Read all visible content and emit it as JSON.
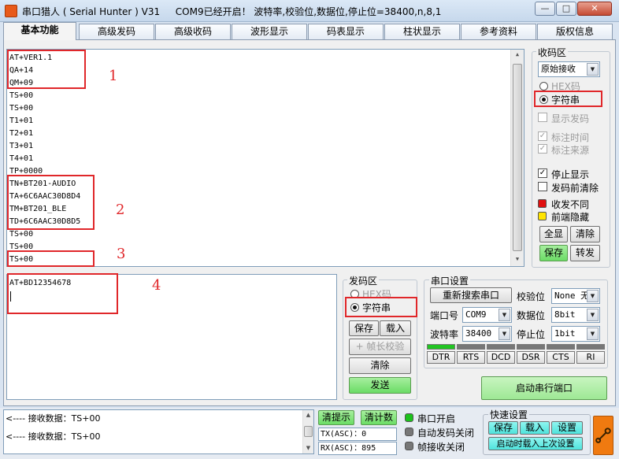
{
  "window": {
    "title": "串口猎人 ( Serial Hunter ) V31",
    "status_message": "COM9已经开启！ 波特率,校验位,数据位,停止位=38400,n,8,1",
    "minimize": "—",
    "maximize": "□",
    "close": "✕"
  },
  "tabs": [
    {
      "label": "基本功能"
    },
    {
      "label": "高级发码"
    },
    {
      "label": "高级收码"
    },
    {
      "label": "波形显示"
    },
    {
      "label": "码表显示"
    },
    {
      "label": "柱状显示"
    },
    {
      "label": "参考资料"
    },
    {
      "label": "版权信息"
    }
  ],
  "receive_area": {
    "lines": [
      "AT+VER1.1",
      "QA+14",
      "QM+09",
      "TS+00",
      "TS+00",
      "T1+01",
      "T2+01",
      "T3+01",
      "T4+01",
      "TP+0000",
      "TN+BT201-AUDIO",
      "TA+6C6AAC30D8D4",
      "TM+BT201_BLE",
      "TD+6C6AAC30D8D5",
      "TS+00",
      "TS+00",
      "TS+00"
    ]
  },
  "annotations": [
    "1",
    "2",
    "3",
    "4"
  ],
  "send_area": {
    "text": "AT+BD12354678"
  },
  "receive_panel": {
    "title": "收码区",
    "mode": "原始接收",
    "hex_label": "HEX码",
    "string_label": "字符串",
    "show_send": "显示发码",
    "mark_time": "标注时间",
    "mark_source": "标注来源",
    "stop_display": "停止显示",
    "clear_before_send": "发码前清除",
    "rx_diff": "收发不同",
    "hide_front": "前端隐藏",
    "show_all": "全显",
    "clear": "清除",
    "save": "保存",
    "convert": "转发"
  },
  "send_panel": {
    "title": "发码区",
    "hex_label": "HEX码",
    "string_label": "字符串",
    "save": "保存",
    "load": "载入",
    "frame_check": "+ 帧长校验",
    "clear": "清除",
    "send": "发送"
  },
  "serial_settings": {
    "title": "串口设置",
    "rescan": "重新搜索串口",
    "parity_label": "校验位",
    "parity_value": "None 无",
    "port_label": "端口号",
    "port_value": "COM9",
    "databits_label": "数据位",
    "databits_value": "8bit",
    "baud_label": "波特率",
    "baud_value": "38400",
    "stopbits_label": "停止位",
    "stopbits_value": "1bit",
    "signals": [
      "DTR",
      "RTS",
      "DCD",
      "DSR",
      "CTS",
      "RI"
    ],
    "start_button": "启动串行端口"
  },
  "status_bar": {
    "log": [
      "<---- 接收数据：TS+00",
      "<---- 接收数据：TS+00"
    ],
    "clear_tip": "清提示",
    "clear_count": "清计数",
    "tx_label": "TX(ASC)：",
    "tx_value": "0",
    "rx_label": "RX(ASC)：",
    "rx_value": "895",
    "port_open": "串口开启",
    "auto_send_off": "自动发码关闭",
    "frame_recv_off": "帧接收关闭",
    "quick_settings": "快速设置",
    "qs_save": "保存",
    "qs_load": "载入",
    "qs_settings": "设置",
    "load_last": "启动时载入上次设置"
  },
  "colors": {
    "annotation_red": "#e0272a",
    "green_button": "#6bdc65",
    "signal_on": "#22c422",
    "led_red": "#e01010",
    "led_yellow": "#ffe400",
    "led_green": "#1cc21c",
    "orange": "#f07a10"
  }
}
